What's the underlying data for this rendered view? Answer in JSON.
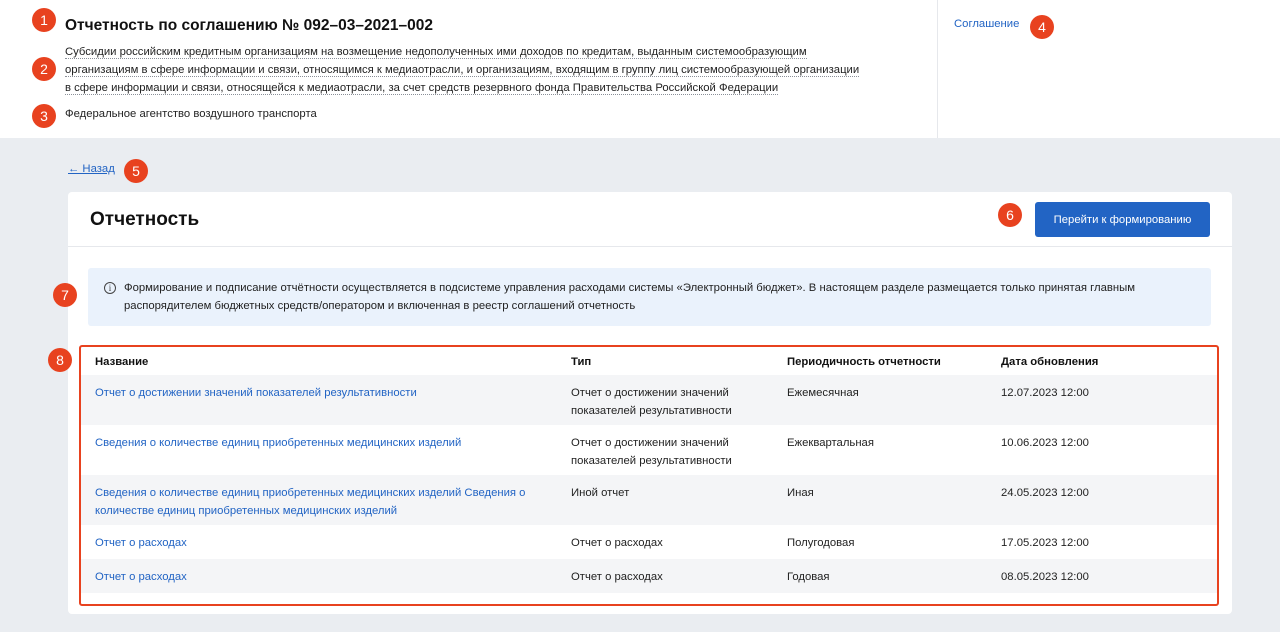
{
  "header": {
    "title": "Отчетность по соглашению № 092–03–2021–002",
    "description": [
      "Субсидии российским кредитным организациям на возмещение недополученных ими доходов по кредитам, выданным системообразующим",
      "организациям в сфере информации и связи, относящимся к медиаотрасли, и организациям, входящим в группу лиц системообразующей организации",
      "в сфере информации и связи, относящейся к медиаотрасли, за счет средств резервного фонда Правительства Российской Федерации"
    ],
    "agency": "Федеральное агентство воздушного транспорта",
    "agreement_link": "Соглашение"
  },
  "markers": [
    "1",
    "2",
    "3",
    "4",
    "5",
    "6",
    "7",
    "8"
  ],
  "back_link": "← Назад",
  "card": {
    "title": "Отчетность",
    "primary_button": "Перейти к формированию",
    "info_icon": "i",
    "info_text": "Формирование и подписание отчётности осуществляется в подсистеме управления расходами системы «Электронный бюджет». В настоящем разделе размещается только принятая главным распорядителем бюджетных средств/оператором и включенная в реестр соглашений отчетность"
  },
  "table": {
    "columns": [
      "Название",
      "Тип",
      "Периодичность отчетности",
      "Дата обновления"
    ],
    "rows": [
      {
        "name": "Отчет о достижении значений показателей результативности",
        "type": "Отчет о достижении значений показателей результативности",
        "period": "Ежемесячная",
        "date": "12.07.2023 12:00"
      },
      {
        "name": "Сведения о количестве единиц приобретенных медицинских изделий",
        "type": "Отчет о достижении значений показателей результативности",
        "period": "Ежеквартальная",
        "date": "10.06.2023 12:00"
      },
      {
        "name": "Сведения о количестве единиц приобретенных медицинских изделий Сведения о количестве единиц приобретенных медицинских изделий",
        "type": "Иной отчет",
        "period": "Иная",
        "date": "24.05.2023 12:00"
      },
      {
        "name": "Отчет о расходах",
        "type": "Отчет о расходах",
        "period": "Полугодовая",
        "date": "17.05.2023 12:00"
      },
      {
        "name": "Отчет о расходах",
        "type": "Отчет о расходах",
        "period": "Годовая",
        "date": "08.05.2023 12:00"
      }
    ]
  },
  "colors": {
    "accent": "#2264c4",
    "marker": "#e8421f",
    "page_bg": "#eaedf1",
    "info_bg": "#eaf2fc"
  }
}
